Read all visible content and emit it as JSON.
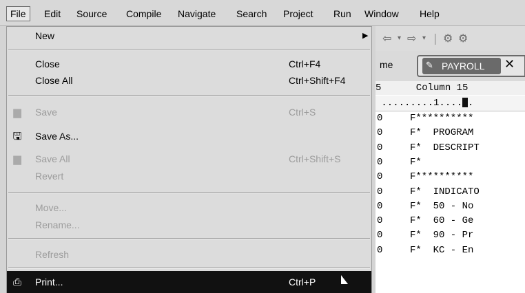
{
  "menubar": {
    "items": [
      "File",
      "Edit",
      "Source",
      "Compile",
      "Navigate",
      "Search",
      "Project",
      "Run",
      "Window",
      "Help"
    ]
  },
  "file_menu": {
    "new": {
      "label": "New"
    },
    "close": {
      "label": "Close",
      "shortcut": "Ctrl+F4"
    },
    "close_all": {
      "label": "Close All",
      "shortcut": "Ctrl+Shift+F4"
    },
    "save": {
      "label": "Save",
      "shortcut": "Ctrl+S"
    },
    "save_as": {
      "label": "Save As..."
    },
    "save_all": {
      "label": "Save All",
      "shortcut": "Ctrl+Shift+S"
    },
    "revert": {
      "label": "Revert"
    },
    "move": {
      "label": "Move..."
    },
    "rename": {
      "label": "Rename..."
    },
    "refresh": {
      "label": "Refresh"
    },
    "print": {
      "label": "Print...",
      "shortcut": "Ctrl+P"
    }
  },
  "editor": {
    "tab_left_label": "me",
    "tab_active_label": "PAYROLL",
    "header_row": "5      Column 15",
    "ruler": " .........1....",
    "ruler_tail": ".",
    "lines": [
      {
        "n": "0",
        "text": "F**********"
      },
      {
        "n": "0",
        "text": "F*  PROGRAM"
      },
      {
        "n": "0",
        "text": "F*  DESCRIPT"
      },
      {
        "n": "0",
        "text": "F*"
      },
      {
        "n": "0",
        "text": "F**********"
      },
      {
        "n": "0",
        "text": "F*  INDICATO"
      },
      {
        "n": "0",
        "text": "F*  50 - No"
      },
      {
        "n": "0",
        "text": "F*  60 - Ge"
      },
      {
        "n": "0",
        "text": "F*  90 - Pr"
      },
      {
        "n": "0",
        "text": "F*  KC - En"
      }
    ]
  },
  "colors": {
    "menu_bg": "#dcdcdc",
    "selected_bg": "#111111",
    "disabled": "#9c9c9c"
  }
}
